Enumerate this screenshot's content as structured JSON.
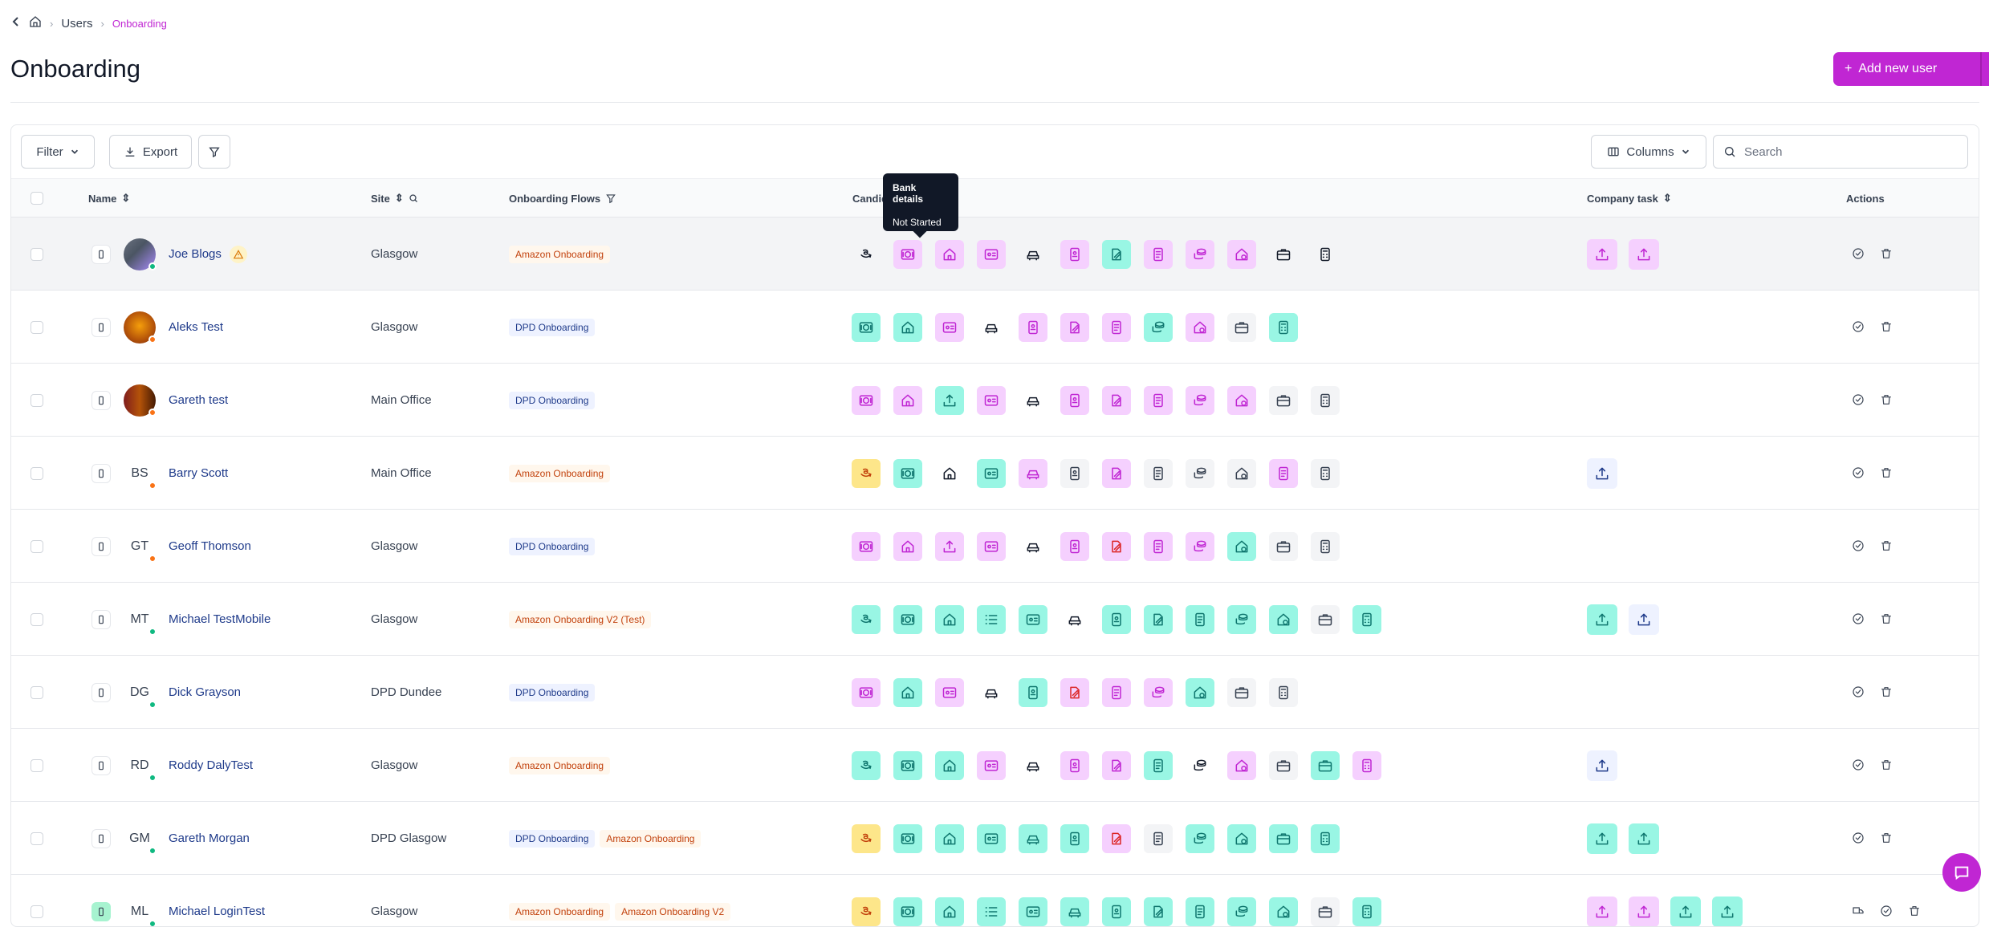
{
  "breadcrumb": {
    "items": [
      "Users",
      "Onboarding"
    ]
  },
  "page": {
    "title": "Onboarding",
    "add_button": "Add new user"
  },
  "toolbar": {
    "filter": "Filter",
    "export": "Export",
    "columns": "Columns",
    "search_placeholder": "Search"
  },
  "table": {
    "headers": {
      "name": "Name",
      "site": "Site",
      "flows": "Onboarding Flows",
      "candidate": "Candidate task",
      "company": "Company task",
      "actions": "Actions"
    }
  },
  "tooltip": {
    "title": "Bank details",
    "status": "Not Started"
  },
  "rows": [
    {
      "name": "Joe Blogs",
      "initials": "",
      "site": "Glasgow",
      "flows": [
        "Amazon Onboarding"
      ],
      "status": "green",
      "warn": true
    },
    {
      "name": "Aleks Test",
      "initials": "",
      "site": "Glasgow",
      "flows": [
        "DPD Onboarding"
      ],
      "status": "orange",
      "warn": false
    },
    {
      "name": "Gareth test",
      "initials": "",
      "site": "Main Office",
      "flows": [
        "DPD Onboarding"
      ],
      "status": "orange",
      "warn": false
    },
    {
      "name": "Barry Scott",
      "initials": "BS",
      "site": "Main Office",
      "flows": [
        "Amazon Onboarding"
      ],
      "status": "orange",
      "warn": false
    },
    {
      "name": "Geoff Thomson",
      "initials": "GT",
      "site": "Glasgow",
      "flows": [
        "DPD Onboarding"
      ],
      "status": "orange",
      "warn": false
    },
    {
      "name": "Michael TestMobile",
      "initials": "MT",
      "site": "Glasgow",
      "flows": [
        "Amazon Onboarding V2 (Test)"
      ],
      "status": "green",
      "warn": false
    },
    {
      "name": "Dick Grayson",
      "initials": "DG",
      "site": "DPD Dundee",
      "flows": [
        "DPD Onboarding"
      ],
      "status": "green",
      "warn": false
    },
    {
      "name": "Roddy DalyTest",
      "initials": "RD",
      "site": "Glasgow",
      "flows": [
        "Amazon Onboarding"
      ],
      "status": "green",
      "warn": false
    },
    {
      "name": "Gareth Morgan",
      "initials": "GM",
      "site": "DPD Glasgow",
      "flows": [
        "DPD Onboarding",
        "Amazon Onboarding"
      ],
      "status": "green",
      "warn": false
    },
    {
      "name": "Michael LoginTest",
      "initials": "ML",
      "site": "Glasgow",
      "flows": [
        "Amazon Onboarding",
        "Amazon Onboarding V2"
      ],
      "status": "green",
      "warn": false
    }
  ]
}
